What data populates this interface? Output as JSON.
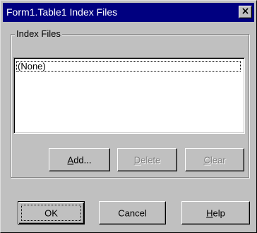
{
  "window": {
    "title": "Form1.Table1 Index Files",
    "close_glyph": "×"
  },
  "group": {
    "label": "Index Files",
    "list_items": [
      "(None)"
    ]
  },
  "buttons": {
    "add": {
      "accel": "A",
      "rest": "dd..."
    },
    "delete": {
      "accel": "D",
      "rest": "elete"
    },
    "clear": {
      "accel": "C",
      "rest": "lear"
    },
    "ok": {
      "label": "OK"
    },
    "cancel": {
      "label": "Cancel"
    },
    "help": {
      "accel": "H",
      "rest": "elp"
    }
  }
}
